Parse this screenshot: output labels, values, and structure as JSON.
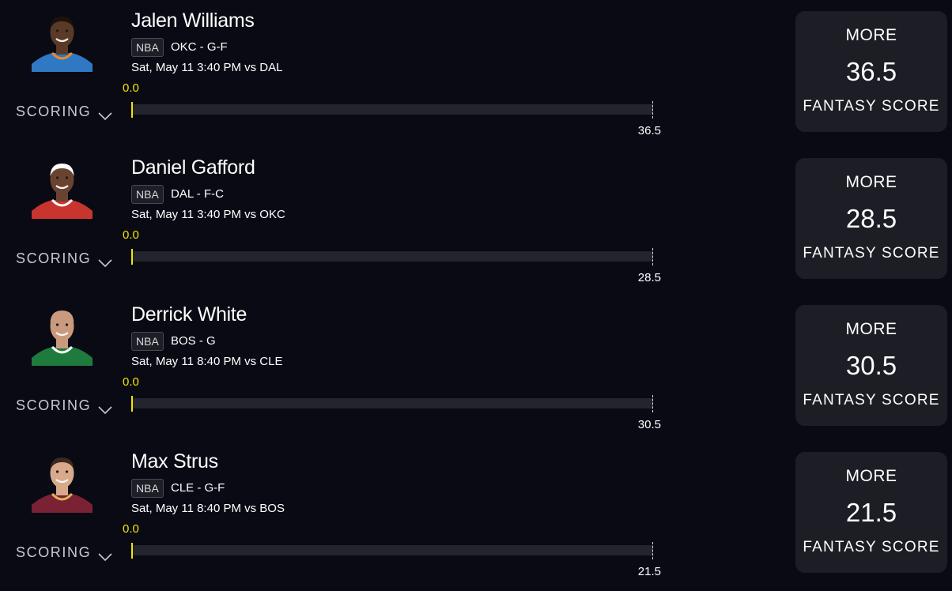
{
  "players": [
    {
      "name": "Jalen Williams",
      "league": "NBA",
      "team_position": "OKC - G-F",
      "game_info": "Sat, May 11 3:40 PM  vs DAL",
      "current_value": "0.0",
      "projection_label": "36.5",
      "progress": 0,
      "category": "SCORING",
      "pick_direction": "MORE",
      "line": "36.5",
      "stat_type": "FANTASY SCORE",
      "jersey_color": "#2f78c4",
      "jersey_trim": "#f08a24",
      "skin_color": "#5a3a26",
      "hair_color": "#1c120c"
    },
    {
      "name": "Daniel Gafford",
      "league": "NBA",
      "team_position": "DAL - F-C",
      "game_info": "Sat, May 11 3:40 PM  vs OKC",
      "current_value": "0.0",
      "projection_label": "28.5",
      "progress": 0,
      "category": "SCORING",
      "pick_direction": "MORE",
      "line": "28.5",
      "stat_type": "FANTASY SCORE",
      "jersey_color": "#c8352e",
      "jersey_trim": "#ffffff",
      "skin_color": "#6a4330",
      "hair_color": "#ffffff"
    },
    {
      "name": "Derrick White",
      "league": "NBA",
      "team_position": "BOS - G",
      "game_info": "Sat, May 11 8:40 PM  vs CLE",
      "current_value": "0.0",
      "projection_label": "30.5",
      "progress": 0,
      "category": "SCORING",
      "pick_direction": "MORE",
      "line": "30.5",
      "stat_type": "FANTASY SCORE",
      "jersey_color": "#1f7a3d",
      "jersey_trim": "#ffffff",
      "skin_color": "#c99a7e",
      "hair_color": "#c99a7e"
    },
    {
      "name": "Max Strus",
      "league": "NBA",
      "team_position": "CLE - G-F",
      "game_info": "Sat, May 11 8:40 PM  vs BOS",
      "current_value": "0.0",
      "projection_label": "21.5",
      "progress": 0,
      "category": "SCORING",
      "pick_direction": "MORE",
      "line": "21.5",
      "stat_type": "FANTASY SCORE",
      "jersey_color": "#7a2233",
      "jersey_trim": "#e0b15a",
      "skin_color": "#d8a98a",
      "hair_color": "#3b2a1e"
    }
  ],
  "icons": {
    "expand": "chevron-down-icon",
    "avatar": "player-headshot"
  }
}
